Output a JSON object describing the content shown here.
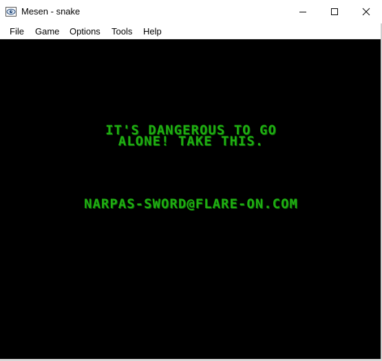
{
  "window": {
    "title": "Mesen - snake",
    "app_icon": "mesen-eye-icon",
    "controls": {
      "minimize": "minimize-icon",
      "maximize": "maximize-icon",
      "close": "close-icon"
    }
  },
  "menu": {
    "items": [
      "File",
      "Game",
      "Options",
      "Tools",
      "Help"
    ]
  },
  "game_screen": {
    "line1": "IT'S DANGEROUS TO GO",
    "line2": "ALONE! TAKE THIS.",
    "line3": "NARPAS-SWORD@FLARE-ON.COM",
    "text_color": "#1fae12",
    "background_color": "#000000"
  }
}
